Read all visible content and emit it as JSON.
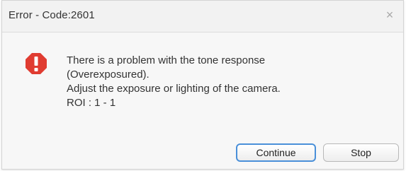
{
  "dialog": {
    "title": "Error - Code:2601",
    "close_glyph": "×",
    "icon": "error-octagon-icon",
    "icon_color": "#e03c31",
    "message_lines": [
      "There is a problem with the tone response",
      "(Overexposured).",
      "Adjust the exposure or lighting of the camera.",
      "ROI : 1 - 1"
    ],
    "buttons": {
      "continue_label": "Continue",
      "stop_label": "Stop"
    },
    "focus_color": "#4a90d9"
  }
}
